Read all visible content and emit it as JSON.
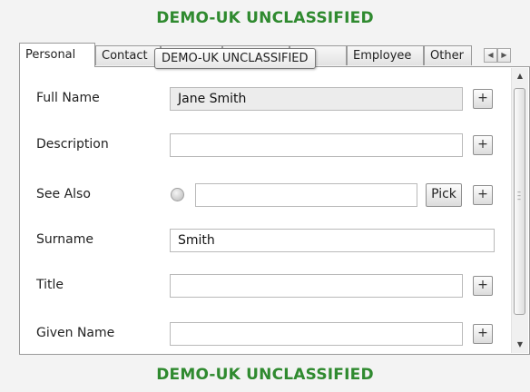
{
  "classification": {
    "top_banner": "DEMO-UK UNCLASSIFIED",
    "bottom_banner": "DEMO-UK UNCLASSIFIED",
    "color": "#2f8a2f"
  },
  "tabs": [
    {
      "label": "Personal",
      "active": true
    },
    {
      "label": "Contact",
      "active": false
    },
    {
      "label": "",
      "active": false
    },
    {
      "label": "",
      "active": false
    },
    {
      "label": "",
      "active": false
    },
    {
      "label": "Employee",
      "active": false
    },
    {
      "label": "Other",
      "active": false
    }
  ],
  "tooltip": {
    "text": "DEMO-UK UNCLASSIFIED"
  },
  "form": {
    "full_name": {
      "label": "Full Name",
      "value": "Jane Smith",
      "add": "+"
    },
    "description": {
      "label": "Description",
      "value": "",
      "add": "+"
    },
    "see_also": {
      "label": "See Also",
      "value": "",
      "pick": "Pick",
      "add": "+"
    },
    "surname": {
      "label": "Surname",
      "value": "Smith"
    },
    "title": {
      "label": "Title",
      "value": "",
      "add": "+"
    },
    "given_name": {
      "label": "Given Name",
      "value": "",
      "add": "+"
    }
  },
  "icons": {
    "tab_scroll_left": "left-arrow-icon",
    "tab_scroll_right": "right-arrow-icon",
    "scroll_up": "up-arrow-icon",
    "scroll_down": "down-arrow-icon"
  }
}
